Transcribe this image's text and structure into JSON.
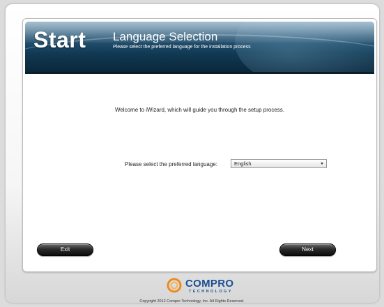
{
  "header": {
    "step_title": "Start",
    "section_title": "Language Selection",
    "section_subtitle": "Please select the preferred language for the installation process"
  },
  "main": {
    "welcome_text": "Welcome to iWizard, which will guide you through the setup process.",
    "language_label": "Please select the preferred language:",
    "language_selected": "English"
  },
  "buttons": {
    "exit_label": "Exit",
    "next_label": "Next"
  },
  "footer": {
    "brand_name": "COMPRO",
    "brand_sub": "TECHNOLOGY",
    "copyright": "Copyright 2012 Compro Technology, Inc. All Rights Reserved."
  },
  "colors": {
    "banner": "#113a55",
    "brand_blue": "#1a4f95",
    "brand_orange": "#f08a1c"
  },
  "icons": {
    "dropdown": "chevron-down-icon",
    "logo": "compro-logo-icon"
  }
}
